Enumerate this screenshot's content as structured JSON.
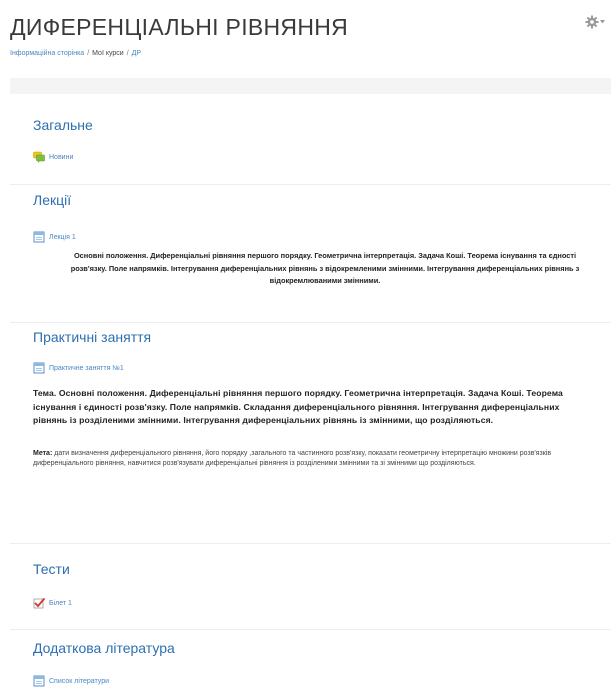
{
  "page": {
    "title": "ДИФЕРЕНЦІАЛЬНІ РІВНЯННЯ"
  },
  "breadcrumb": {
    "home": "Інформаційна сторінка",
    "my_courses": "Мої курси",
    "current": "ДР",
    "separator": "/"
  },
  "icons": {
    "settings": "gear-icon",
    "forum": "forum-icon",
    "file": "file-icon",
    "quiz": "quiz-icon"
  },
  "colors": {
    "link": "#4a87c4",
    "section_title": "#2d6fb0"
  },
  "sections": {
    "general": {
      "title": "Загальне",
      "news": "Новини"
    },
    "lectures": {
      "title": "Лекції",
      "lecture1": "Лекція 1",
      "summary": "Основні положення. Диференціальні рівняння першого порядку. Геометрична інтерпретація. Задача Коші. Теорема існування та єдності розв'язку. Поле напрямків. Інтегрування диференціальних рівнянь з відокремленими змінними. Інтегрування диференціальних рівнянь з відокремлюваними змінними."
    },
    "practical": {
      "title": "Практичні заняття",
      "item1": "Практичне заняття №1",
      "topic": "Тема. Основні положення. Диференціальні рівняння першого порядку. Геометрична інтерпретація. Задача Коші. Теорема існування і єдиності розв'язку. Поле  напрямків. Складання диференціального рівняння. Інтегрування диференціальних рівнянь із розділеними змінними. Інтегрування диференціальних рівнянь із змінними, що розділяються.",
      "goal_label": "Мета:",
      "goal_text": "дати визначення диференціального рівняння, його порядку ,загального та частинного розв'язку, показати геометричну інтерпретацію множини розв'язків диференціального рівняння, навчитися розв'язувати диференціальні рівняння із розділеними змінними та зі змінними що розділяються."
    },
    "tests": {
      "title": "Тести",
      "ticket1": "Білет 1"
    },
    "literature": {
      "title": "Додаткова література",
      "list": "Список літератури"
    }
  }
}
